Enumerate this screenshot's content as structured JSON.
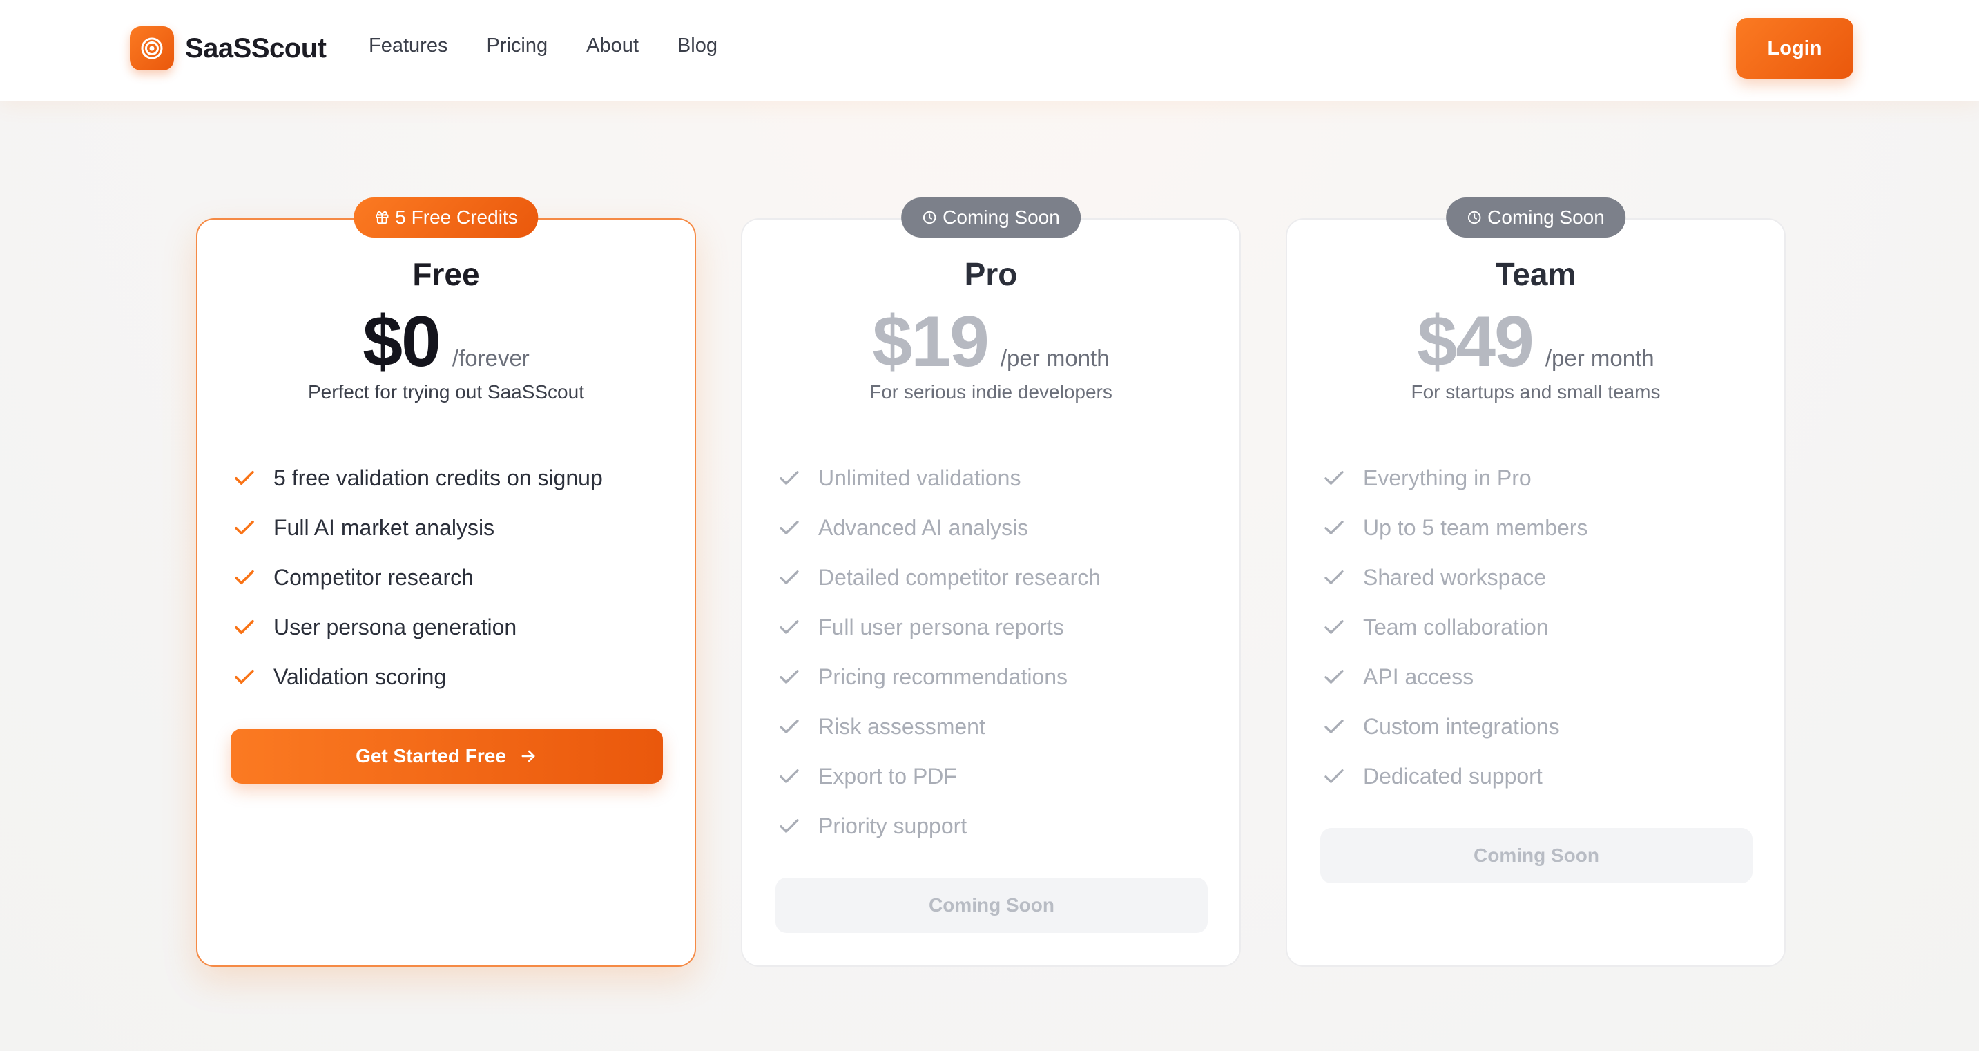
{
  "brand": {
    "name": "SaaSScout",
    "logo_icon": "target-icon",
    "accent": "#f97316"
  },
  "nav": {
    "items": [
      "Features",
      "Pricing",
      "About",
      "Blog"
    ]
  },
  "header": {
    "login_label": "Login"
  },
  "plans": [
    {
      "badge": "5 Free Credits",
      "badge_icon": "gift-icon",
      "name": "Free",
      "price": "$0",
      "period": "/forever",
      "subtitle": "Perfect for trying out SaaSScout",
      "features": [
        "5 free validation credits on signup",
        "Full AI market analysis",
        "Competitor research",
        "User persona generation",
        "Validation scoring"
      ],
      "cta": "Get Started Free",
      "cta_icon": "arrow-right-icon"
    },
    {
      "badge": "Coming Soon",
      "badge_icon": "clock-icon",
      "name": "Pro",
      "price": "$19",
      "period": "/per month",
      "subtitle": "For serious indie developers",
      "features": [
        "Unlimited validations",
        "Advanced AI analysis",
        "Detailed competitor research",
        "Full user persona reports",
        "Pricing recommendations",
        "Risk assessment",
        "Export to PDF",
        "Priority support"
      ],
      "cta": "Coming Soon"
    },
    {
      "badge": "Coming Soon",
      "badge_icon": "clock-icon",
      "name": "Team",
      "price": "$49",
      "period": "/per month",
      "subtitle": "For startups and small teams",
      "features": [
        "Everything in Pro",
        "Up to 5 team members",
        "Shared workspace",
        "Team collaboration",
        "API access",
        "Custom integrations",
        "Dedicated support"
      ],
      "cta": "Coming Soon"
    }
  ]
}
